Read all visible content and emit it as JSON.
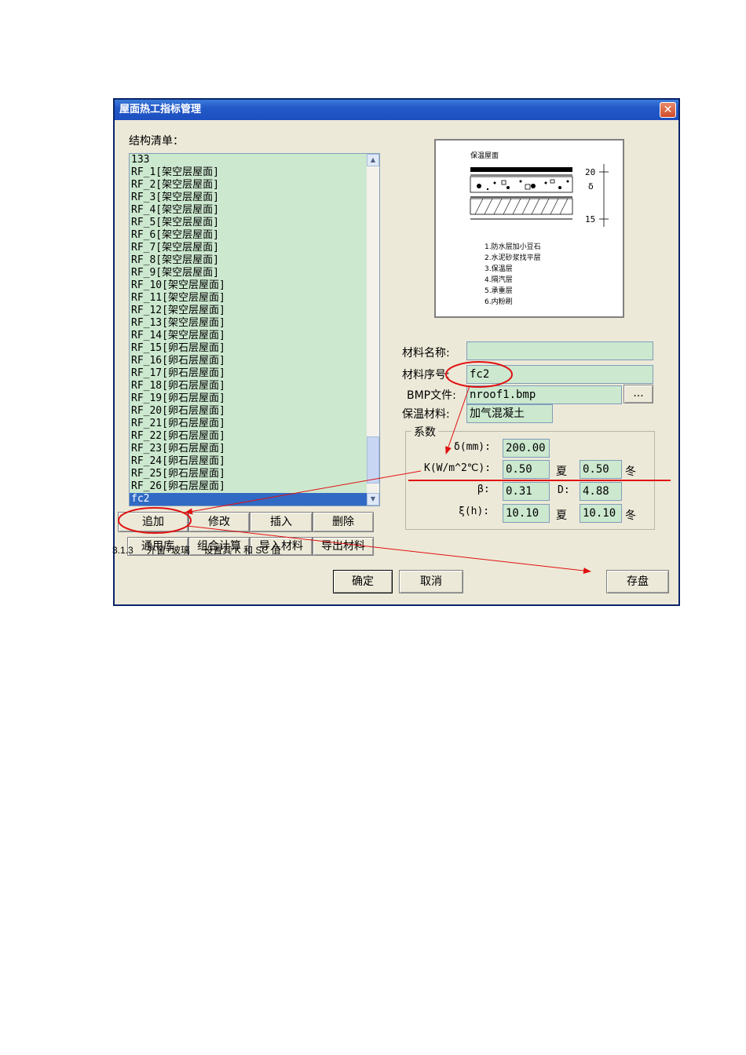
{
  "dialog": {
    "title": "屋面热工指标管理",
    "close_glyph": "✕"
  },
  "structure_list": {
    "label": "结构清单：",
    "items": [
      "133",
      "RF_1[架空层屋面]",
      "RF_2[架空层屋面]",
      "RF_3[架空层屋面]",
      "RF_4[架空层屋面]",
      "RF_5[架空层屋面]",
      "RF_6[架空层屋面]",
      "RF_7[架空层屋面]",
      "RF_8[架空层屋面]",
      "RF_9[架空层屋面]",
      "RF_10[架空层屋面]",
      "RF_11[架空层屋面]",
      "RF_12[架空层屋面]",
      "RF_13[架空层屋面]",
      "RF_14[架空层屋面]",
      "RF_15[卵石层屋面]",
      "RF_16[卵石层屋面]",
      "RF_17[卵石层屋面]",
      "RF_18[卵石层屋面]",
      "RF_19[卵石层屋面]",
      "RF_20[卵石层屋面]",
      "RF_21[卵石层屋面]",
      "RF_22[卵石层屋面]",
      "RF_23[卵石层屋面]",
      "RF_24[卵石层屋面]",
      "RF_25[卵石层屋面]",
      "RF_26[卵石层屋面]",
      "fc2"
    ],
    "selected_index": 27
  },
  "list_buttons": {
    "row1": [
      "追加",
      "修改",
      "插入",
      "删除"
    ],
    "row2": [
      "通用库",
      "组合计算",
      "导入材料",
      "导出材料"
    ]
  },
  "preview": {
    "title": "保温屋面",
    "dim_top": "20",
    "dim_delta": "δ",
    "dim_bottom": "15",
    "legend": [
      "1.防水层加小豆石",
      "2.水泥砂浆找平层",
      "3.保温层",
      "4.隔汽层",
      "5.承重层",
      "6.内粉刷"
    ]
  },
  "form": {
    "name_label": "材料名称:",
    "name_value": "",
    "seq_label": "材料序号:",
    "seq_value": "fc2",
    "bmp_label": "BMP文件:",
    "bmp_value": "nroof1.bmp",
    "browse_label": "...",
    "insul_label": "保温材料:",
    "insul_value": "加气混凝土"
  },
  "coefficients": {
    "group_label": "系数",
    "delta_label": "δ(mm):",
    "delta_value": "200.00",
    "k_label": "K(W/m^2℃):",
    "k_summer": "0.50",
    "summer_label": "夏",
    "k_winter": "0.50",
    "winter_label": "冬",
    "beta_label": "β:",
    "beta_value": "0.31",
    "d_label": "D:",
    "d_value": "4.88",
    "xi_label": "ξ(h):",
    "xi_summer": "10.10",
    "xi_winter": "10.10"
  },
  "bottom_buttons": {
    "ok": "确定",
    "cancel": "取消",
    "save": "存盘"
  },
  "caption": [
    "3.1.3",
    "外窗+玻璃",
    "设置其 K 和 SC 值"
  ],
  "colors": {
    "title_bar": "#2459c8",
    "field_bg": "#cce8cf",
    "selection": "#316ac5",
    "annotation": "#e01010"
  }
}
